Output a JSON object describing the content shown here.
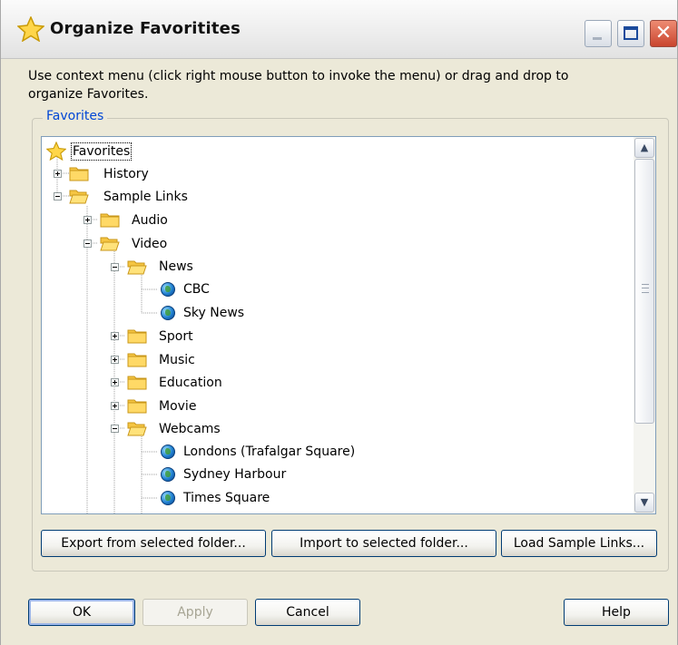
{
  "window": {
    "title": "Organize Favoritites",
    "controls": {
      "minimize": "minimize",
      "maximize": "maximize",
      "close": "✕"
    }
  },
  "instructions": "Use context menu (click right mouse button to invoke the menu) or drag and drop to organize Favorites.",
  "group_label": "Favorites",
  "tree": {
    "items": [
      {
        "label": "Favorites",
        "icon": "star-icon",
        "expander": "none",
        "selected": true
      },
      {
        "label": "History",
        "icon": "folder-icon",
        "expander": "plus"
      },
      {
        "label": "Sample Links",
        "icon": "folder-open-icon",
        "expander": "minus"
      },
      {
        "label": "Audio",
        "icon": "folder-icon",
        "expander": "plus"
      },
      {
        "label": "Video",
        "icon": "folder-open-icon",
        "expander": "minus"
      },
      {
        "label": "News",
        "icon": "folder-open-icon",
        "expander": "minus"
      },
      {
        "label": "CBC",
        "icon": "globe-icon",
        "expander": "none"
      },
      {
        "label": "Sky News",
        "icon": "globe-icon",
        "expander": "none"
      },
      {
        "label": "Sport",
        "icon": "folder-icon",
        "expander": "plus"
      },
      {
        "label": "Music",
        "icon": "folder-icon",
        "expander": "plus"
      },
      {
        "label": "Education",
        "icon": "folder-icon",
        "expander": "plus"
      },
      {
        "label": "Movie",
        "icon": "folder-icon",
        "expander": "plus"
      },
      {
        "label": "Webcams",
        "icon": "folder-open-icon",
        "expander": "minus"
      },
      {
        "label": "Londons (Trafalgar Square)",
        "icon": "globe-icon",
        "expander": "none"
      },
      {
        "label": "Sydney Harbour",
        "icon": "globe-icon",
        "expander": "none"
      },
      {
        "label": "Times Square",
        "icon": "globe-icon",
        "expander": "none"
      }
    ]
  },
  "scrollbar": {
    "up_glyph": "▲",
    "down_glyph": "▼",
    "grip": "≡"
  },
  "folder_buttons": {
    "export": "Export from selected folder...",
    "import": "Import to selected folder...",
    "load": "Load Sample Links..."
  },
  "dialog_buttons": {
    "ok": "OK",
    "apply": "Apply",
    "cancel": "Cancel",
    "help": "Help"
  },
  "colors": {
    "dialog_bg": "#ece9d8",
    "accent": "#0046d5",
    "border": "#003c74",
    "folder": "#f5c542"
  }
}
